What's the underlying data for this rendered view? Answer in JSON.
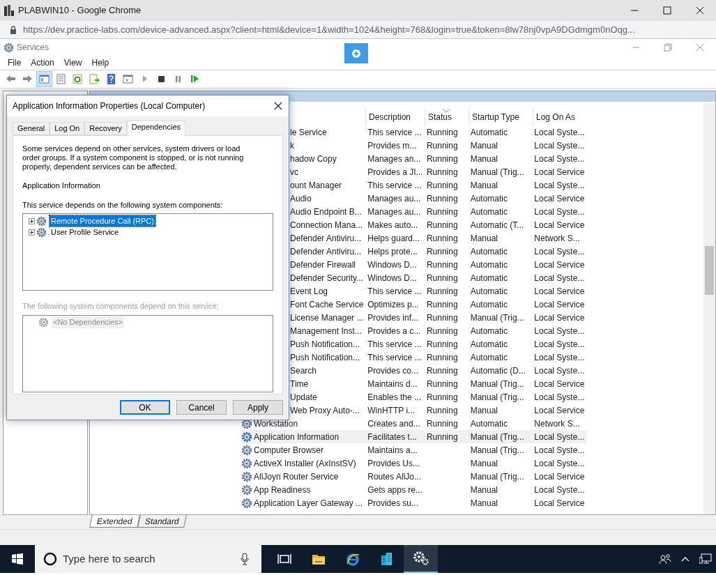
{
  "browser": {
    "title": "PLABWIN10 - Google Chrome",
    "url": "https://dev.practice-labs.com/device-advanced.aspx?client=html&device=1&width=1024&height=768&login=true&token=8lw78nj0vpA9DGdmgm0nOqg..."
  },
  "services_window": {
    "title": "Services",
    "menu": [
      "File",
      "Action",
      "View",
      "Help"
    ],
    "toolbar": [
      {
        "kind": "back",
        "pressed": false
      },
      {
        "kind": "forward",
        "pressed": false
      },
      {
        "kind": "tree",
        "pressed": true
      },
      {
        "kind": "properties",
        "pressed": false
      },
      {
        "kind": "refresh",
        "pressed": false
      },
      {
        "kind": "export",
        "pressed": false
      },
      {
        "kind": "help",
        "pressed": false
      },
      {
        "kind": "pane",
        "pressed": false
      },
      {
        "kind": "start",
        "pressed": false
      },
      {
        "kind": "stop",
        "pressed": false
      },
      {
        "kind": "pause",
        "pressed": false
      },
      {
        "kind": "resume",
        "pressed": false
      }
    ],
    "columns": [
      {
        "label": "Description",
        "sorted": false
      },
      {
        "label": "Status",
        "sorted": true
      },
      {
        "label": "Startup Type",
        "sorted": false
      },
      {
        "label": "Log On As",
        "sorted": false
      }
    ],
    "rows": [
      {
        "name": "le Service",
        "description": "This service ...",
        "status": "Running",
        "startup_type": "Automatic",
        "log_on_as": "Local Syste...",
        "clipped": true,
        "selected": false
      },
      {
        "name": "k",
        "description": "Provides m...",
        "status": "Running",
        "startup_type": "Manual",
        "log_on_as": "Local Syste...",
        "clipped": true,
        "selected": false
      },
      {
        "name": "hadow Copy",
        "description": "Manages an...",
        "status": "Running",
        "startup_type": "Manual",
        "log_on_as": "Local Syste...",
        "clipped": true,
        "selected": false
      },
      {
        "name": "vc",
        "description": "Provides a JI...",
        "status": "Running",
        "startup_type": "Manual (Trig...",
        "log_on_as": "Local Service",
        "clipped": true,
        "selected": false
      },
      {
        "name": "ount Manager",
        "description": "This service ...",
        "status": "Running",
        "startup_type": "Manual",
        "log_on_as": "Local Syste...",
        "clipped": true,
        "selected": false
      },
      {
        "name": "Audio",
        "description": "Manages au...",
        "status": "Running",
        "startup_type": "Automatic",
        "log_on_as": "Local Service",
        "clipped": true,
        "selected": false
      },
      {
        "name": "Audio Endpoint B...",
        "description": "Manages au...",
        "status": "Running",
        "startup_type": "Automatic",
        "log_on_as": "Local Syste...",
        "clipped": true,
        "selected": false
      },
      {
        "name": "Connection Mana...",
        "description": "Makes auto...",
        "status": "Running",
        "startup_type": "Automatic (T...",
        "log_on_as": "Local Service",
        "clipped": true,
        "selected": false
      },
      {
        "name": "Defender Antiviru...",
        "description": "Helps guard...",
        "status": "Running",
        "startup_type": "Manual",
        "log_on_as": "Network S...",
        "clipped": true,
        "selected": false
      },
      {
        "name": "Defender Antiviru...",
        "description": "Helps prote...",
        "status": "Running",
        "startup_type": "Automatic",
        "log_on_as": "Local Syste...",
        "clipped": true,
        "selected": false
      },
      {
        "name": "Defender Firewall",
        "description": "Windows D...",
        "status": "Running",
        "startup_type": "Automatic",
        "log_on_as": "Local Service",
        "clipped": true,
        "selected": false
      },
      {
        "name": "Defender Security...",
        "description": "Windows D...",
        "status": "Running",
        "startup_type": "Automatic",
        "log_on_as": "Local Syste...",
        "clipped": true,
        "selected": false
      },
      {
        "name": "Event Log",
        "description": "This service ...",
        "status": "Running",
        "startup_type": "Automatic",
        "log_on_as": "Local Service",
        "clipped": true,
        "selected": false
      },
      {
        "name": "Font Cache Service",
        "description": "Optimizes p...",
        "status": "Running",
        "startup_type": "Automatic",
        "log_on_as": "Local Service",
        "clipped": true,
        "selected": false
      },
      {
        "name": "License Manager ...",
        "description": "Provides inf...",
        "status": "Running",
        "startup_type": "Manual (Trig...",
        "log_on_as": "Local Service",
        "clipped": true,
        "selected": false
      },
      {
        "name": "Management Inst...",
        "description": "Provides a c...",
        "status": "Running",
        "startup_type": "Automatic",
        "log_on_as": "Local Syste...",
        "clipped": true,
        "selected": false
      },
      {
        "name": "Push Notification...",
        "description": "This service ...",
        "status": "Running",
        "startup_type": "Automatic",
        "log_on_as": "Local Syste...",
        "clipped": true,
        "selected": false
      },
      {
        "name": "Push Notification...",
        "description": "This service ...",
        "status": "Running",
        "startup_type": "Automatic",
        "log_on_as": "Local Syste...",
        "clipped": true,
        "selected": false
      },
      {
        "name": "Search",
        "description": "Provides co...",
        "status": "Running",
        "startup_type": "Automatic (D...",
        "log_on_as": "Local Syste...",
        "clipped": true,
        "selected": false
      },
      {
        "name": "Time",
        "description": "Maintains d...",
        "status": "Running",
        "startup_type": "Manual (Trig...",
        "log_on_as": "Local Service",
        "clipped": true,
        "selected": false
      },
      {
        "name": "Update",
        "description": "Enables the ...",
        "status": "Running",
        "startup_type": "Manual (Trig...",
        "log_on_as": "Local Syste...",
        "clipped": true,
        "selected": false
      },
      {
        "name": "Web Proxy Auto-...",
        "description": "WinHTTP i...",
        "status": "Running",
        "startup_type": "Manual",
        "log_on_as": "Local Service",
        "clipped": true,
        "selected": false
      },
      {
        "name": "Workstation",
        "description": "Creates and...",
        "status": "Running",
        "startup_type": "Automatic",
        "log_on_as": "Network S...",
        "clipped": false,
        "selected": false
      },
      {
        "name": "Application Information",
        "description": "Facilitates t...",
        "status": "Running",
        "startup_type": "Manual (Trig...",
        "log_on_as": "Local Syste...",
        "clipped": false,
        "selected": true
      },
      {
        "name": "Computer Browser",
        "description": "Maintains a...",
        "startup_type": "Manual (Trig...",
        "log_on_as": "Local Syste...",
        "clipped": false,
        "selected": false
      },
      {
        "name": "ActiveX Installer (AxInstSV)",
        "description": "Provides Us...",
        "startup_type": "Manual",
        "log_on_as": "Local Syste...",
        "clipped": false,
        "selected": false
      },
      {
        "name": "AllJoyn Router Service",
        "description": "Routes AllJo...",
        "startup_type": "Manual (Trig...",
        "log_on_as": "Local Service",
        "clipped": false,
        "selected": false
      },
      {
        "name": "App Readiness",
        "description": "Gets apps re...",
        "startup_type": "Manual",
        "log_on_as": "Local Syste...",
        "clipped": false,
        "selected": false
      },
      {
        "name": "Application Layer Gateway ...",
        "description": "Provides su...",
        "startup_type": "Manual",
        "log_on_as": "Local Service",
        "clipped": false,
        "selected": false
      }
    ],
    "view_tabs": [
      {
        "label": "Extended",
        "selected": true
      },
      {
        "label": "Standard",
        "selected": false
      }
    ]
  },
  "dialog": {
    "title": "Application Information Properties (Local Computer)",
    "tabs": [
      {
        "label": "General",
        "selected": false
      },
      {
        "label": "Log On",
        "selected": false
      },
      {
        "label": "Recovery",
        "selected": false
      },
      {
        "label": "Dependencies",
        "selected": true
      }
    ],
    "intro": "Some services depend on other services, system drivers or load order groups. If a system component is stopped, or is not running properly, dependent services can be affected.",
    "service_name": "Application Information",
    "depends_label": "This service depends on the following system components:",
    "depends_items": [
      {
        "label": "Remote Procedure Call (RPC)",
        "selected": true
      },
      {
        "label": "User Profile Service",
        "selected": false
      }
    ],
    "dependents_label": "The following system components depend on this service:",
    "dependents_disabled": true,
    "dependents_items": [
      {
        "label": "<No Dependencies>"
      }
    ],
    "buttons": [
      {
        "label": "OK",
        "default": true
      },
      {
        "label": "Cancel",
        "default": false
      },
      {
        "label": "Apply",
        "default": false
      }
    ]
  },
  "taskbar": {
    "search_placeholder": "Type here to search",
    "apps": [
      {
        "kind": "task-view",
        "active": false
      },
      {
        "kind": "folder",
        "active": false
      },
      {
        "kind": "browser",
        "active": false
      },
      {
        "kind": "building",
        "active": false
      },
      {
        "kind": "gear",
        "active": true
      }
    ]
  }
}
